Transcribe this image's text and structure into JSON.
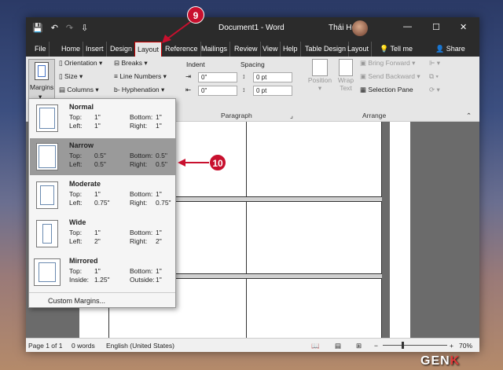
{
  "titlebar": {
    "qat": [
      "💾",
      "↶",
      "↷",
      "⇩"
    ],
    "title": "Document1 - Word",
    "user": "Thái Hoc",
    "min": "—",
    "max": "☐",
    "close": "✕"
  },
  "tabs": [
    "File",
    "Home",
    "Insert",
    "Design",
    "Layout",
    "Reference",
    "Mailings",
    "Review",
    "View",
    "Help",
    "Table Design",
    "Layout",
    "Tell me",
    "Share"
  ],
  "ribbon": {
    "margins": "Margins",
    "orientation": "Orientation",
    "size": "Size",
    "columns": "Columns",
    "breaks": "Breaks",
    "line_numbers": "Line Numbers",
    "hyphenation": "Hyphenation",
    "indent": "Indent",
    "spacing": "Spacing",
    "indent_left": "0\"",
    "indent_right": "0\"",
    "spacing_before": "0 pt",
    "spacing_after": "0 pt",
    "paragraph_group": "Paragraph",
    "position": "Position",
    "wrap_text": "Wrap Text",
    "bring_forward": "Bring Forward",
    "send_backward": "Send Backward",
    "selection_pane": "Selection Pane",
    "arrange_group": "Arrange"
  },
  "margins_menu": {
    "options": [
      {
        "name": "Normal",
        "r1": [
          "Top:",
          "1\"",
          "Bottom:",
          "1\""
        ],
        "r2": [
          "Left:",
          "1\"",
          "Right:",
          "1\""
        ]
      },
      {
        "name": "Narrow",
        "r1": [
          "Top:",
          "0.5\"",
          "Bottom:",
          "0.5\""
        ],
        "r2": [
          "Left:",
          "0.5\"",
          "Right:",
          "0.5\""
        ]
      },
      {
        "name": "Moderate",
        "r1": [
          "Top:",
          "1\"",
          "Bottom:",
          "1\""
        ],
        "r2": [
          "Left:",
          "0.75\"",
          "Right:",
          "0.75\""
        ]
      },
      {
        "name": "Wide",
        "r1": [
          "Top:",
          "1\"",
          "Bottom:",
          "1\""
        ],
        "r2": [
          "Left:",
          "2\"",
          "Right:",
          "2\""
        ]
      },
      {
        "name": "Mirrored",
        "r1": [
          "Top:",
          "1\"",
          "Bottom:",
          "1\""
        ],
        "r2": [
          "Inside:",
          "1.25\"",
          "Outside:",
          "1\""
        ]
      }
    ],
    "custom": "Custom Margins..."
  },
  "status": {
    "page": "Page 1 of 1",
    "words": "0 words",
    "language": "English (United States)",
    "zoom": "70%"
  },
  "callouts": {
    "step9": "9",
    "step10": "10"
  },
  "watermark": {
    "gen": "GEN",
    "k": "K"
  },
  "colors": {
    "accent_red": "#c8102e",
    "titlebar": "#2b2b2b",
    "selected": "#9a9a9a"
  }
}
